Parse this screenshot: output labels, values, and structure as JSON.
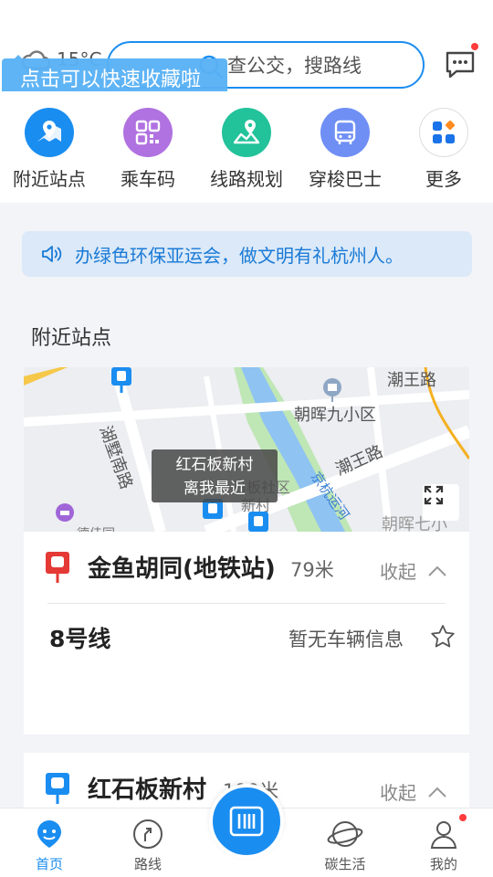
{
  "header": {
    "weather_temp": "15°C",
    "search_placeholder": "查公交，搜路线",
    "tip": "点击可以快速收藏啦"
  },
  "quick_actions": [
    {
      "label": "附近站点",
      "icon": "location-map-icon",
      "color": "#1a8df0"
    },
    {
      "label": "乘车码",
      "icon": "qr-code-icon",
      "color": "#b072e0"
    },
    {
      "label": "线路规划",
      "icon": "route-plan-icon",
      "color": "#22c29a"
    },
    {
      "label": "穿梭巴士",
      "icon": "shuttle-bus-icon",
      "color": "#6f8ff5"
    },
    {
      "label": "更多",
      "icon": "more-grid-icon",
      "color": "#ffffff"
    }
  ],
  "notice": {
    "text": "办绿色环保亚运会，做文明有礼杭州人。"
  },
  "nearby": {
    "title": "附近站点",
    "map": {
      "labels": [
        "潮王路",
        "朝晖九小区",
        "湖墅南路",
        "潮王路",
        "京杭运河",
        "朝晖七小",
        "石板社区",
        "新村",
        "德佳园"
      ],
      "bubble_line1": "红石板新村",
      "bubble_line2": "离我最近"
    },
    "stations": [
      {
        "name": "金鱼胡同(地铁站)",
        "distance": "79米",
        "collapse_label": "收起",
        "type": "metro",
        "lines": [
          {
            "name": "8号线",
            "info": "暂无车辆信息"
          }
        ]
      },
      {
        "name": "红石板新村",
        "distance": "199米",
        "collapse_label": "收起",
        "type": "bus"
      }
    ]
  },
  "tabbar": {
    "tabs": [
      {
        "label": "首页",
        "icon": "home-face-icon"
      },
      {
        "label": "路线",
        "icon": "route-compass-icon"
      },
      {
        "label": "碳生活",
        "icon": "planet-icon"
      },
      {
        "label": "我的",
        "icon": "user-icon"
      }
    ]
  }
}
